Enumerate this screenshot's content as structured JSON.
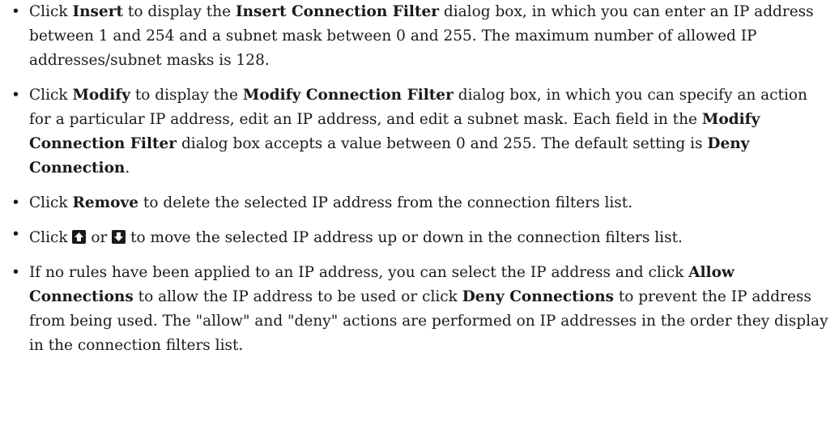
{
  "bullets": {
    "insert": {
      "pre": "Click ",
      "button": "Insert",
      "mid": " to display the ",
      "dialog": "Insert Connection Filter",
      "post": " dialog box, in which you can enter an IP address between 1 and 254 and a subnet mask between 0 and 255. The maximum number of allowed IP addresses/subnet masks is 128."
    },
    "modify": {
      "pre": "Click ",
      "button": "Modify",
      "mid": " to display the ",
      "dialog": "Modify Connection Filter",
      "mid2": " dialog box, in which you can specify an action for a particular IP address, edit an IP address, and edit a subnet mask. Each field in the ",
      "dialog2": "Modify Connection Filter",
      "mid3": " dialog box accepts a value between 0 and 255. The default setting is ",
      "default": "Deny Connection",
      "post": "."
    },
    "remove": {
      "pre": "Click ",
      "button": "Remove",
      "post": " to delete the selected IP address from the connection filters list."
    },
    "move": {
      "pre": "Click ",
      "or": " or ",
      "post": " to move the selected IP address up or down in the connection filters list.",
      "up_icon": "up-arrow-icon",
      "down_icon": "down-arrow-icon"
    },
    "rules": {
      "pre": "If no rules have been applied to an IP address, you can select the IP address and click ",
      "allow": "Allow Connections",
      "mid": " to allow the IP address to be used or click ",
      "deny": "Deny Connections",
      "post": " to prevent the IP address from being used. The \"allow\" and \"deny\" actions are performed on IP addresses in the order they display in the connection filters list."
    }
  },
  "bullet_char": "•"
}
